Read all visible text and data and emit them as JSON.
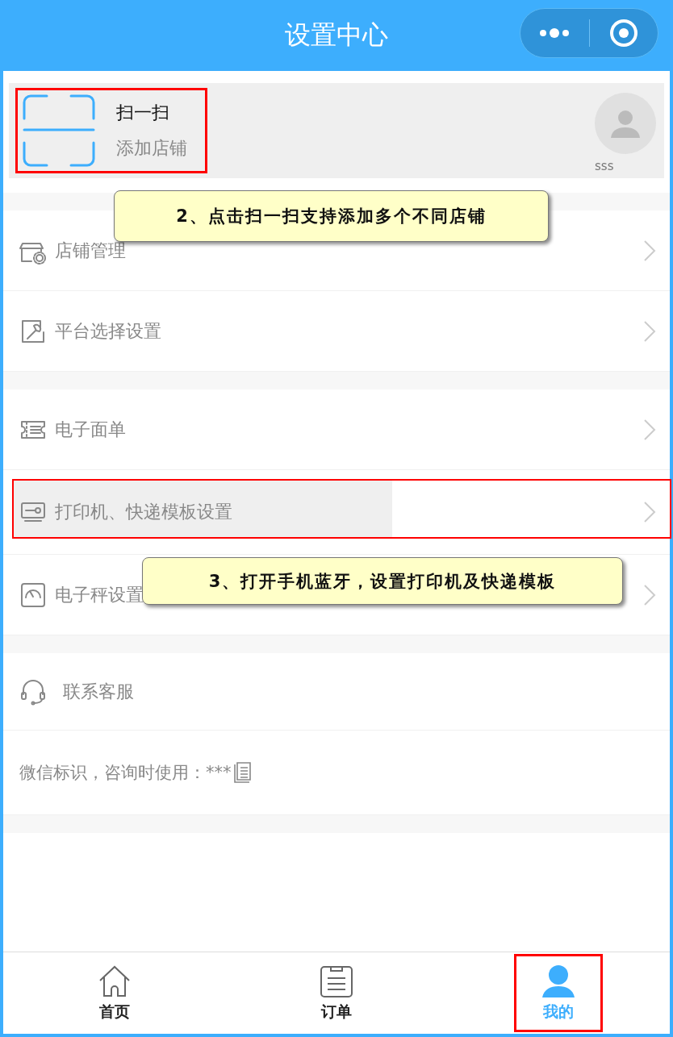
{
  "header": {
    "title": "设置中心"
  },
  "scan_card": {
    "title": "扫一扫",
    "subtitle": "添加店铺",
    "user_name": "sss",
    "outlined": true
  },
  "groups": [
    {
      "items": [
        {
          "label": "店铺管理",
          "highlighted": false,
          "outlined": false
        },
        {
          "label": "平台选择设置",
          "highlighted": false,
          "outlined": false
        }
      ]
    },
    {
      "items": [
        {
          "label": "电子面单",
          "highlighted": false,
          "outlined": false
        },
        {
          "label": "打印机、快递模板设置",
          "highlighted": true,
          "outlined": true
        },
        {
          "label": "电子秤设置",
          "highlighted": false,
          "outlined": false
        }
      ]
    }
  ],
  "support": {
    "label": "联系客服",
    "wechat_id": "微信标识，咨询时使用：***"
  },
  "tabs": [
    {
      "label": "首页",
      "selected": false,
      "outlined": false
    },
    {
      "label": "订单",
      "selected": false,
      "outlined": false
    },
    {
      "label": "我的",
      "selected": true,
      "outlined": true
    }
  ],
  "callouts": [
    {
      "text": "2、点击扫一扫支持添加多个不同店铺"
    },
    {
      "text": "3、打开手机蓝牙，设置打印机及快递模板"
    }
  ]
}
